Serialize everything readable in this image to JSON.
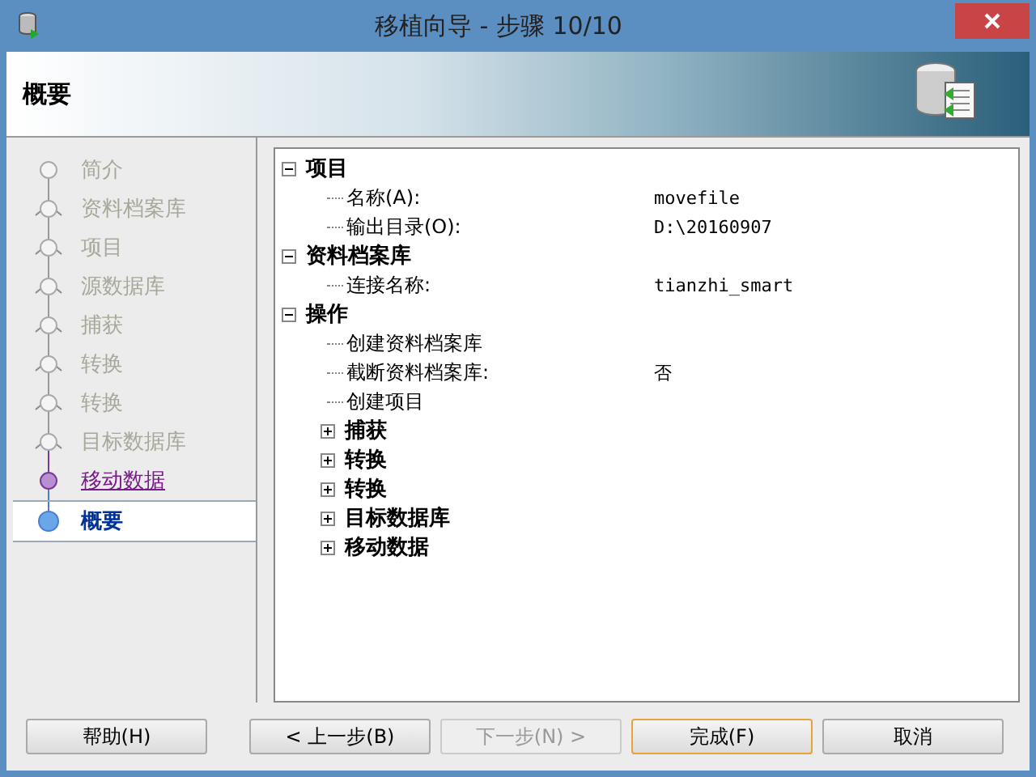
{
  "window": {
    "title": "移植向导 - 步骤 10/10"
  },
  "header": {
    "title": "概要"
  },
  "steps": [
    {
      "label": "简介",
      "kind": "disabled",
      "selected": false
    },
    {
      "label": "资料档案库",
      "kind": "disabled",
      "selected": false
    },
    {
      "label": "项目",
      "kind": "disabled",
      "selected": false
    },
    {
      "label": "源数据库",
      "kind": "disabled",
      "selected": false
    },
    {
      "label": "捕获",
      "kind": "disabled",
      "selected": false
    },
    {
      "label": "转换",
      "kind": "disabled",
      "selected": false
    },
    {
      "label": "转换",
      "kind": "disabled",
      "selected": false
    },
    {
      "label": "目标数据库",
      "kind": "disabled",
      "selected": false
    },
    {
      "label": "移动数据",
      "kind": "link",
      "selected": false
    },
    {
      "label": "概要",
      "kind": "current",
      "selected": true
    }
  ],
  "tree": [
    {
      "label": "项目",
      "expanded": true,
      "children": [
        {
          "label": "名称(A):",
          "value": "movefile"
        },
        {
          "label": "输出目录(O):",
          "value": "D:\\20160907"
        }
      ]
    },
    {
      "label": "资料档案库",
      "expanded": true,
      "children": [
        {
          "label": "连接名称:",
          "value": "tianzhi_smart"
        }
      ]
    },
    {
      "label": "操作",
      "expanded": true,
      "children": [
        {
          "label": "创建资料档案库"
        },
        {
          "label": "截断资料档案库:",
          "value": "否"
        },
        {
          "label": "创建项目"
        },
        {
          "label": "捕获",
          "expanded": false
        },
        {
          "label": "转换",
          "expanded": false
        },
        {
          "label": "转换",
          "expanded": false
        },
        {
          "label": "目标数据库",
          "expanded": false
        },
        {
          "label": "移动数据",
          "expanded": false
        }
      ]
    }
  ],
  "buttons": [
    {
      "label": "帮助(H)",
      "disabled": false,
      "focused": false
    },
    {
      "label": "< 上一步(B)",
      "disabled": false,
      "focused": false
    },
    {
      "label": "下一步(N) >",
      "disabled": true,
      "focused": false
    },
    {
      "label": "完成(F)",
      "disabled": false,
      "focused": true
    },
    {
      "label": "取消",
      "disabled": false,
      "focused": false
    }
  ]
}
